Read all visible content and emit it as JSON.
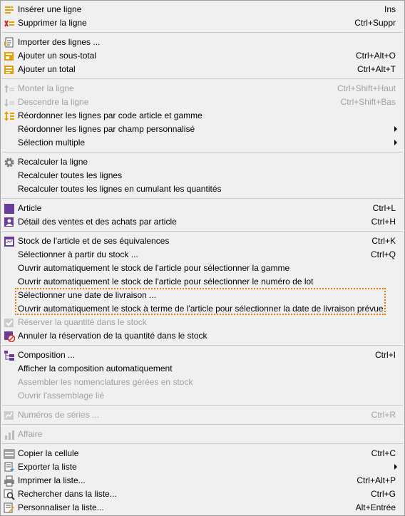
{
  "menu": {
    "items": [
      {
        "label": "Insérer une ligne",
        "shortcut": "Ins",
        "icon": "insert-row-icon",
        "disabled": false
      },
      {
        "label": "Supprimer la ligne",
        "shortcut": "Ctrl+Suppr",
        "icon": "delete-row-icon",
        "disabled": false
      },
      {
        "label": "Importer des lignes ...",
        "shortcut": "",
        "icon": "import-lines-icon",
        "disabled": false
      },
      {
        "label": "Ajouter un sous-total",
        "shortcut": "Ctrl+Alt+O",
        "icon": "subtotal-icon",
        "disabled": false
      },
      {
        "label": "Ajouter un total",
        "shortcut": "Ctrl+Alt+T",
        "icon": "total-icon",
        "disabled": false
      },
      {
        "label": "Monter la ligne",
        "shortcut": "Ctrl+Shift+Haut",
        "icon": "move-up-icon",
        "disabled": true
      },
      {
        "label": "Descendre la ligne",
        "shortcut": "Ctrl+Shift+Bas",
        "icon": "move-down-icon",
        "disabled": true
      },
      {
        "label": "Réordonner les lignes par code article et gamme",
        "shortcut": "",
        "icon": "reorder-icon",
        "disabled": false
      },
      {
        "label": "Réordonner les lignes par champ personnalisé",
        "shortcut": "",
        "icon": "",
        "disabled": false,
        "submenu": true
      },
      {
        "label": "Sélection multiple",
        "shortcut": "",
        "icon": "",
        "disabled": false,
        "submenu": true
      },
      {
        "label": "Recalculer la ligne",
        "shortcut": "",
        "icon": "gear-icon",
        "disabled": false
      },
      {
        "label": "Recalculer toutes les lignes",
        "shortcut": "",
        "icon": "",
        "disabled": false
      },
      {
        "label": "Recalculer toutes les lignes en cumulant les quantités",
        "shortcut": "",
        "icon": "",
        "disabled": false
      },
      {
        "label": "Article",
        "shortcut": "Ctrl+L",
        "icon": "article-icon",
        "disabled": false
      },
      {
        "label": "Détail des ventes et des achats par article",
        "shortcut": "Ctrl+H",
        "icon": "sales-detail-icon",
        "disabled": false
      },
      {
        "label": "Stock de l'article et de ses équivalences",
        "shortcut": "Ctrl+K",
        "icon": "stock-icon",
        "disabled": false
      },
      {
        "label": "Sélectionner à partir du stock ...",
        "shortcut": "Ctrl+Q",
        "icon": "",
        "disabled": false
      },
      {
        "label": "Ouvrir automatiquement le stock de l'article pour sélectionner la gamme",
        "shortcut": "",
        "icon": "",
        "disabled": false
      },
      {
        "label": "Ouvrir automatiquement le stock de l'article pour sélectionner le numéro de lot",
        "shortcut": "",
        "icon": "",
        "disabled": false
      },
      {
        "label": "Sélectionner une date de livraison ...",
        "shortcut": "",
        "icon": "",
        "disabled": false
      },
      {
        "label": "Ouvrir automatiquement le stock à terme de l'article pour sélectionner la date de livraison prévue",
        "shortcut": "",
        "icon": "",
        "disabled": false
      },
      {
        "label": "Réserver la quantité dans le stock",
        "shortcut": "",
        "icon": "reserve-icon",
        "disabled": true
      },
      {
        "label": "Annuler la réservation de la quantité dans le stock",
        "shortcut": "",
        "icon": "cancel-reservation-icon",
        "disabled": false
      },
      {
        "label": "Composition ...",
        "shortcut": "Ctrl+I",
        "icon": "composition-icon",
        "disabled": false
      },
      {
        "label": "Afficher la composition automatiquement",
        "shortcut": "",
        "icon": "",
        "disabled": false
      },
      {
        "label": "Assembler les nomenclatures gérées en stock",
        "shortcut": "",
        "icon": "",
        "disabled": true
      },
      {
        "label": "Ouvrir l'assemblage lié",
        "shortcut": "",
        "icon": "",
        "disabled": true
      },
      {
        "label": "Numéros de séries ...",
        "shortcut": "Ctrl+R",
        "icon": "serial-numbers-icon",
        "disabled": true
      },
      {
        "label": "Affaire",
        "shortcut": "",
        "icon": "affaire-icon",
        "disabled": true
      },
      {
        "label": "Copier la cellule",
        "shortcut": "Ctrl+C",
        "icon": "copy-icon",
        "disabled": false
      },
      {
        "label": "Exporter la liste",
        "shortcut": "",
        "icon": "export-icon",
        "disabled": false,
        "submenu": true
      },
      {
        "label": "Imprimer la liste...",
        "shortcut": "Ctrl+Alt+P",
        "icon": "print-icon",
        "disabled": false
      },
      {
        "label": "Rechercher dans la liste...",
        "shortcut": "Ctrl+G",
        "icon": "search-icon",
        "disabled": false
      },
      {
        "label": "Personnaliser la liste...",
        "shortcut": "Alt+Entrée",
        "icon": "customize-list-icon",
        "disabled": false
      }
    ]
  },
  "colors": {
    "highlight_border": "#e07b00",
    "disabled_text": "#a0a0a0",
    "icon_orange": "#e8a000",
    "icon_purple": "#6a3d9a",
    "icon_red": "#d32f2f",
    "icon_gray": "#777777"
  }
}
